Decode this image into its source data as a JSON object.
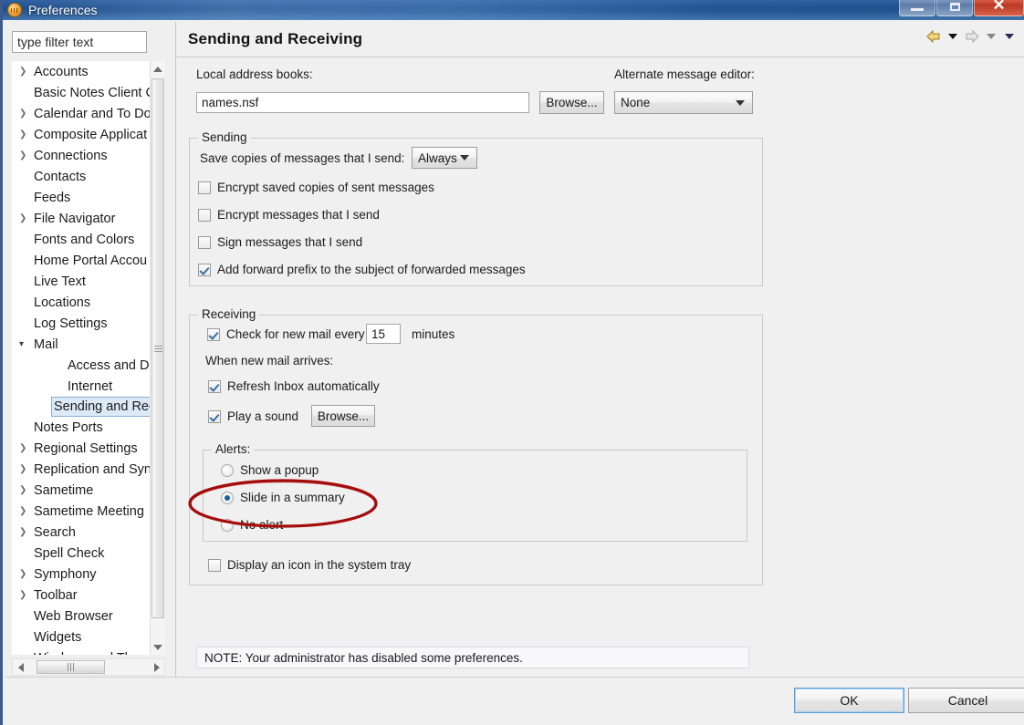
{
  "window": {
    "title": "Preferences",
    "icon": "app-icon",
    "controls": {
      "minimize": "minimize",
      "maximize": "maximize",
      "close": "close"
    }
  },
  "sidebar": {
    "filter": {
      "value": "type filter text",
      "placeholder": "type filter text"
    },
    "items": [
      {
        "label": "Accounts",
        "level": 1,
        "twisty": "collapsed"
      },
      {
        "label": "Basic Notes Client C",
        "level": 1,
        "twisty": "none"
      },
      {
        "label": "Calendar and To Do",
        "level": 1,
        "twisty": "collapsed"
      },
      {
        "label": "Composite Applicat",
        "level": 1,
        "twisty": "collapsed"
      },
      {
        "label": "Connections",
        "level": 1,
        "twisty": "collapsed"
      },
      {
        "label": "Contacts",
        "level": 1,
        "twisty": "none"
      },
      {
        "label": "Feeds",
        "level": 1,
        "twisty": "none"
      },
      {
        "label": "File Navigator",
        "level": 1,
        "twisty": "collapsed"
      },
      {
        "label": "Fonts and Colors",
        "level": 1,
        "twisty": "none"
      },
      {
        "label": "Home Portal Accou",
        "level": 1,
        "twisty": "none"
      },
      {
        "label": "Live Text",
        "level": 1,
        "twisty": "none"
      },
      {
        "label": "Locations",
        "level": 1,
        "twisty": "none"
      },
      {
        "label": "Log Settings",
        "level": 1,
        "twisty": "none"
      },
      {
        "label": "Mail",
        "level": 1,
        "twisty": "expanded"
      },
      {
        "label": "Access and Dele",
        "level": 2,
        "twisty": "none"
      },
      {
        "label": "Internet",
        "level": 2,
        "twisty": "none"
      },
      {
        "label": "Sending and Rec",
        "level": 2,
        "twisty": "none",
        "selected": true
      },
      {
        "label": "Notes Ports",
        "level": 1,
        "twisty": "none"
      },
      {
        "label": "Regional Settings",
        "level": 1,
        "twisty": "collapsed"
      },
      {
        "label": "Replication and Syn",
        "level": 1,
        "twisty": "collapsed"
      },
      {
        "label": "Sametime",
        "level": 1,
        "twisty": "collapsed"
      },
      {
        "label": "Sametime Meeting",
        "level": 1,
        "twisty": "collapsed"
      },
      {
        "label": "Search",
        "level": 1,
        "twisty": "collapsed"
      },
      {
        "label": "Spell Check",
        "level": 1,
        "twisty": "none"
      },
      {
        "label": "Symphony",
        "level": 1,
        "twisty": "collapsed"
      },
      {
        "label": "Toolbar",
        "level": 1,
        "twisty": "collapsed"
      },
      {
        "label": "Web Browser",
        "level": 1,
        "twisty": "none"
      },
      {
        "label": "Widgets",
        "level": 1,
        "twisty": "none"
      },
      {
        "label": "Windows and The",
        "level": 1,
        "twisty": "none",
        "clipped": true
      }
    ]
  },
  "main": {
    "title": "Sending and Receiving",
    "nav": {
      "back_icon": "back-arrow-icon",
      "back_menu_icon": "chevron-down-icon",
      "forward_icon": "forward-arrow-icon",
      "forward_menu_icon": "chevron-down-icon",
      "view_menu_icon": "chevron-down-icon"
    },
    "local_address_books": {
      "label": "Local address books:",
      "value": "names.nsf",
      "browse_label": "Browse..."
    },
    "alternate_editor": {
      "label": "Alternate message editor:",
      "value": "None"
    },
    "sending": {
      "legend": "Sending",
      "save_copies_label": "Save copies of messages that I send:",
      "save_copies_value": "Always",
      "checkboxes": [
        {
          "label": "Encrypt saved copies of sent messages",
          "checked": false
        },
        {
          "label": "Encrypt messages that I send",
          "checked": false
        },
        {
          "label": "Sign messages that I send",
          "checked": false
        },
        {
          "label": "Add forward prefix to the subject of forwarded messages",
          "checked": true
        }
      ]
    },
    "receiving": {
      "legend": "Receiving",
      "check_mail_label": "Check for new mail every",
      "check_mail_checked": true,
      "interval_value": "15",
      "interval_units": "minutes",
      "when_arrives_label": "When new mail arrives:",
      "refresh_inbox": {
        "label": "Refresh Inbox automatically",
        "checked": true
      },
      "play_sound": {
        "label": "Play a sound",
        "checked": true,
        "browse_label": "Browse..."
      },
      "alerts": {
        "legend": "Alerts:",
        "options": [
          {
            "label": "Show a popup",
            "selected": false
          },
          {
            "label": "Slide in a summary",
            "selected": true
          },
          {
            "label": "No alert",
            "selected": false
          }
        ]
      },
      "system_tray": {
        "label": "Display an icon in the system tray",
        "checked": false
      }
    },
    "note": "NOTE: Your administrator has disabled some preferences."
  },
  "annotation": {
    "shape": "ellipse",
    "color": "#a50d0d",
    "target": "Slide in a summary"
  },
  "footer": {
    "ok_label": "OK",
    "cancel_label": "Cancel"
  }
}
